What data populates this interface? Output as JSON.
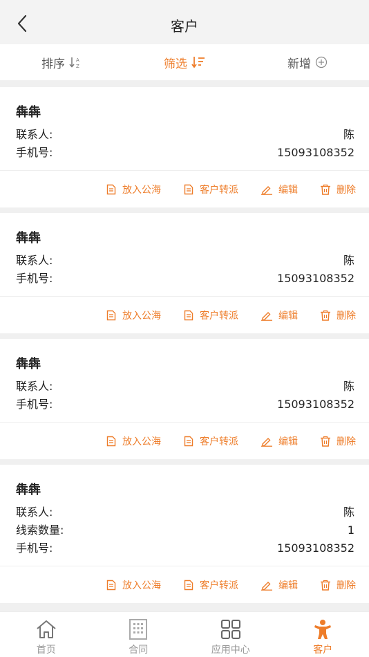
{
  "header": {
    "title": "客户"
  },
  "toolbar": {
    "sort_label": "排序",
    "filter_label": "筛选",
    "add_label": "新增"
  },
  "labels": {
    "contact": "联系人:",
    "phone": "手机号:",
    "leads": "线索数量:"
  },
  "actions": {
    "sea": "放入公海",
    "transfer": "客户转派",
    "edit": "编辑",
    "delete": "删除"
  },
  "customers": [
    {
      "name": "犇犇",
      "contact": "陈",
      "phone": "15093108352"
    },
    {
      "name": "犇犇",
      "contact": "陈",
      "phone": "15093108352"
    },
    {
      "name": "犇犇",
      "contact": "陈",
      "phone": "15093108352"
    },
    {
      "name": "犇犇",
      "contact": "陈",
      "leads": "1",
      "phone": "15093108352"
    }
  ],
  "tabbar": {
    "home": "首页",
    "contract": "合同",
    "apps": "应用中心",
    "customer": "客户"
  },
  "colors": {
    "accent": "#ee7d2a",
    "inactive": "#999999",
    "background": "#f0f0f0"
  }
}
